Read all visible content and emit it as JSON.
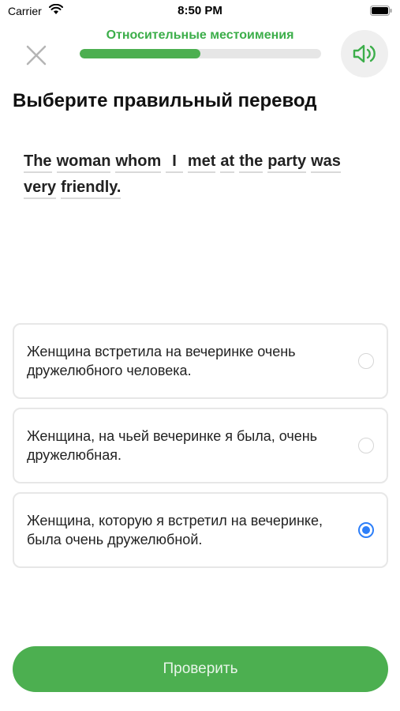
{
  "status_bar": {
    "carrier": "Carrier",
    "time": "8:50 PM"
  },
  "header": {
    "lesson_title": "Относительные местоимения",
    "progress_fraction": 0.5,
    "close_icon": "close-icon",
    "speaker_icon": "speaker-icon",
    "accent_color": "#4caf50"
  },
  "question": {
    "title": "Выберите правильный перевод",
    "words": [
      "The",
      "woman",
      "whom",
      "I",
      "met",
      "at",
      "the",
      "party",
      "was",
      "very",
      "friendly."
    ]
  },
  "options": [
    {
      "text": "Женщина встретила на вечеринке очень дружелюбного человека.",
      "selected": false
    },
    {
      "text": "Женщина, на чьей вечеринке я была, очень дружелюбная.",
      "selected": false
    },
    {
      "text": "Женщина, которую я встретил на вечеринке, была очень дружелюбной.",
      "selected": true
    }
  ],
  "check_button": {
    "label": "Проверить"
  },
  "colors": {
    "selected_radio": "#2d7ff9",
    "button": "#4caf50",
    "title_green": "#3cae4a"
  }
}
